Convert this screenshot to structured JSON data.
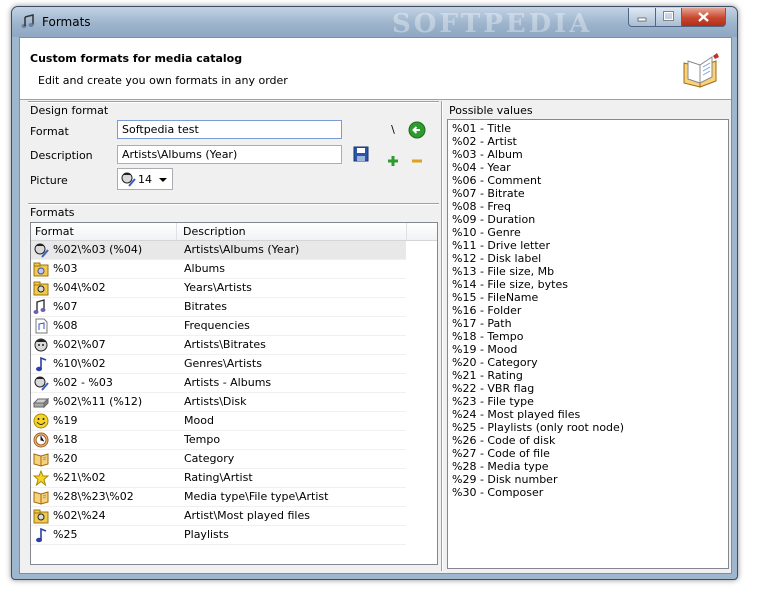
{
  "window": {
    "title": "Formats",
    "watermark": "SOFTPEDIA",
    "title_icon": "music-notes-icon",
    "controls": [
      "minimize-icon",
      "maximize-icon",
      "close-icon"
    ]
  },
  "header": {
    "title": "Custom formats for media catalog",
    "subtitle": "Edit and create you own formats in any order",
    "icon": "open-book-icon"
  },
  "design_format": {
    "group_label": "Design format",
    "format_label": "Format",
    "format_value": "Softpedia test",
    "description_label": "Description",
    "description_value": "Artists\\Albums (Year)",
    "picture_label": "Picture",
    "picture_value": "14",
    "backslash_button": "\\",
    "icons": [
      "back-arrow-icon",
      "save-disk-icon",
      "add-plus-icon",
      "remove-minus-icon"
    ]
  },
  "formats": {
    "group_label": "Formats",
    "columns": [
      "Format",
      "Description"
    ],
    "rows": [
      {
        "icon": "face-pen-icon",
        "format": "%02\\%03 (%04)",
        "description": "Artists\\Albums (Year)",
        "selected": true
      },
      {
        "icon": "folder-disk-icon",
        "format": "%03",
        "description": "Albums"
      },
      {
        "icon": "folder-artist-icon",
        "format": "%04\\%02",
        "description": "Years\\Artists"
      },
      {
        "icon": "music-note-wave-icon",
        "format": "%07",
        "description": "Bitrates"
      },
      {
        "icon": "file-audio-icon",
        "format": "%08",
        "description": "Frequencies"
      },
      {
        "icon": "face-artist-icon",
        "format": "%02\\%07",
        "description": "Artists\\Bitrates"
      },
      {
        "icon": "music-note-icon",
        "format": "%10\\%02",
        "description": "Genres\\Artists"
      },
      {
        "icon": "face-pen-icon",
        "format": "%02 - %03",
        "description": "Artists - Albums"
      },
      {
        "icon": "disk-drive-icon",
        "format": "%02\\%11 (%12)",
        "description": "Artists\\Disk"
      },
      {
        "icon": "smiley-icon",
        "format": "%19",
        "description": "Mood"
      },
      {
        "icon": "clock-face-icon",
        "format": "%18",
        "description": "Tempo"
      },
      {
        "icon": "open-book-icon",
        "format": "%20",
        "description": "Category"
      },
      {
        "icon": "star-icon",
        "format": "%21\\%02",
        "description": "Rating\\Artist"
      },
      {
        "icon": "open-book-icon",
        "format": "%28\\%23\\%02",
        "description": "Media type\\File type\\Artist"
      },
      {
        "icon": "folder-artist-icon",
        "format": "%02\\%24",
        "description": "Artist\\Most played files"
      },
      {
        "icon": "music-note-icon",
        "format": "%25",
        "description": "Playlists"
      }
    ]
  },
  "possible_values": {
    "group_label": "Possible values",
    "items": [
      "%01 - Title",
      "%02 - Artist",
      "%03 - Album",
      "%04 - Year",
      "%06 - Comment",
      "%07 - Bitrate",
      "%08 - Freq",
      "%09 - Duration",
      "%10 - Genre",
      "%11 - Drive letter",
      "%12 - Disk label",
      "%13 - File size, Mb",
      "%14 - File size, bytes",
      "%15 - FileName",
      "%16 - Folder",
      "%17 - Path",
      "%18 - Tempo",
      "%19 - Mood",
      "%20 - Category",
      "%21 - Rating",
      "%22 - VBR flag",
      "%23 - File type",
      "%24 - Most played files",
      "%25 - Playlists (only root node)",
      "%26 - Code of disk",
      "%27 - Code of file",
      "%28 - Media type",
      "%29 - Disk number",
      "%30 - Composer"
    ]
  }
}
